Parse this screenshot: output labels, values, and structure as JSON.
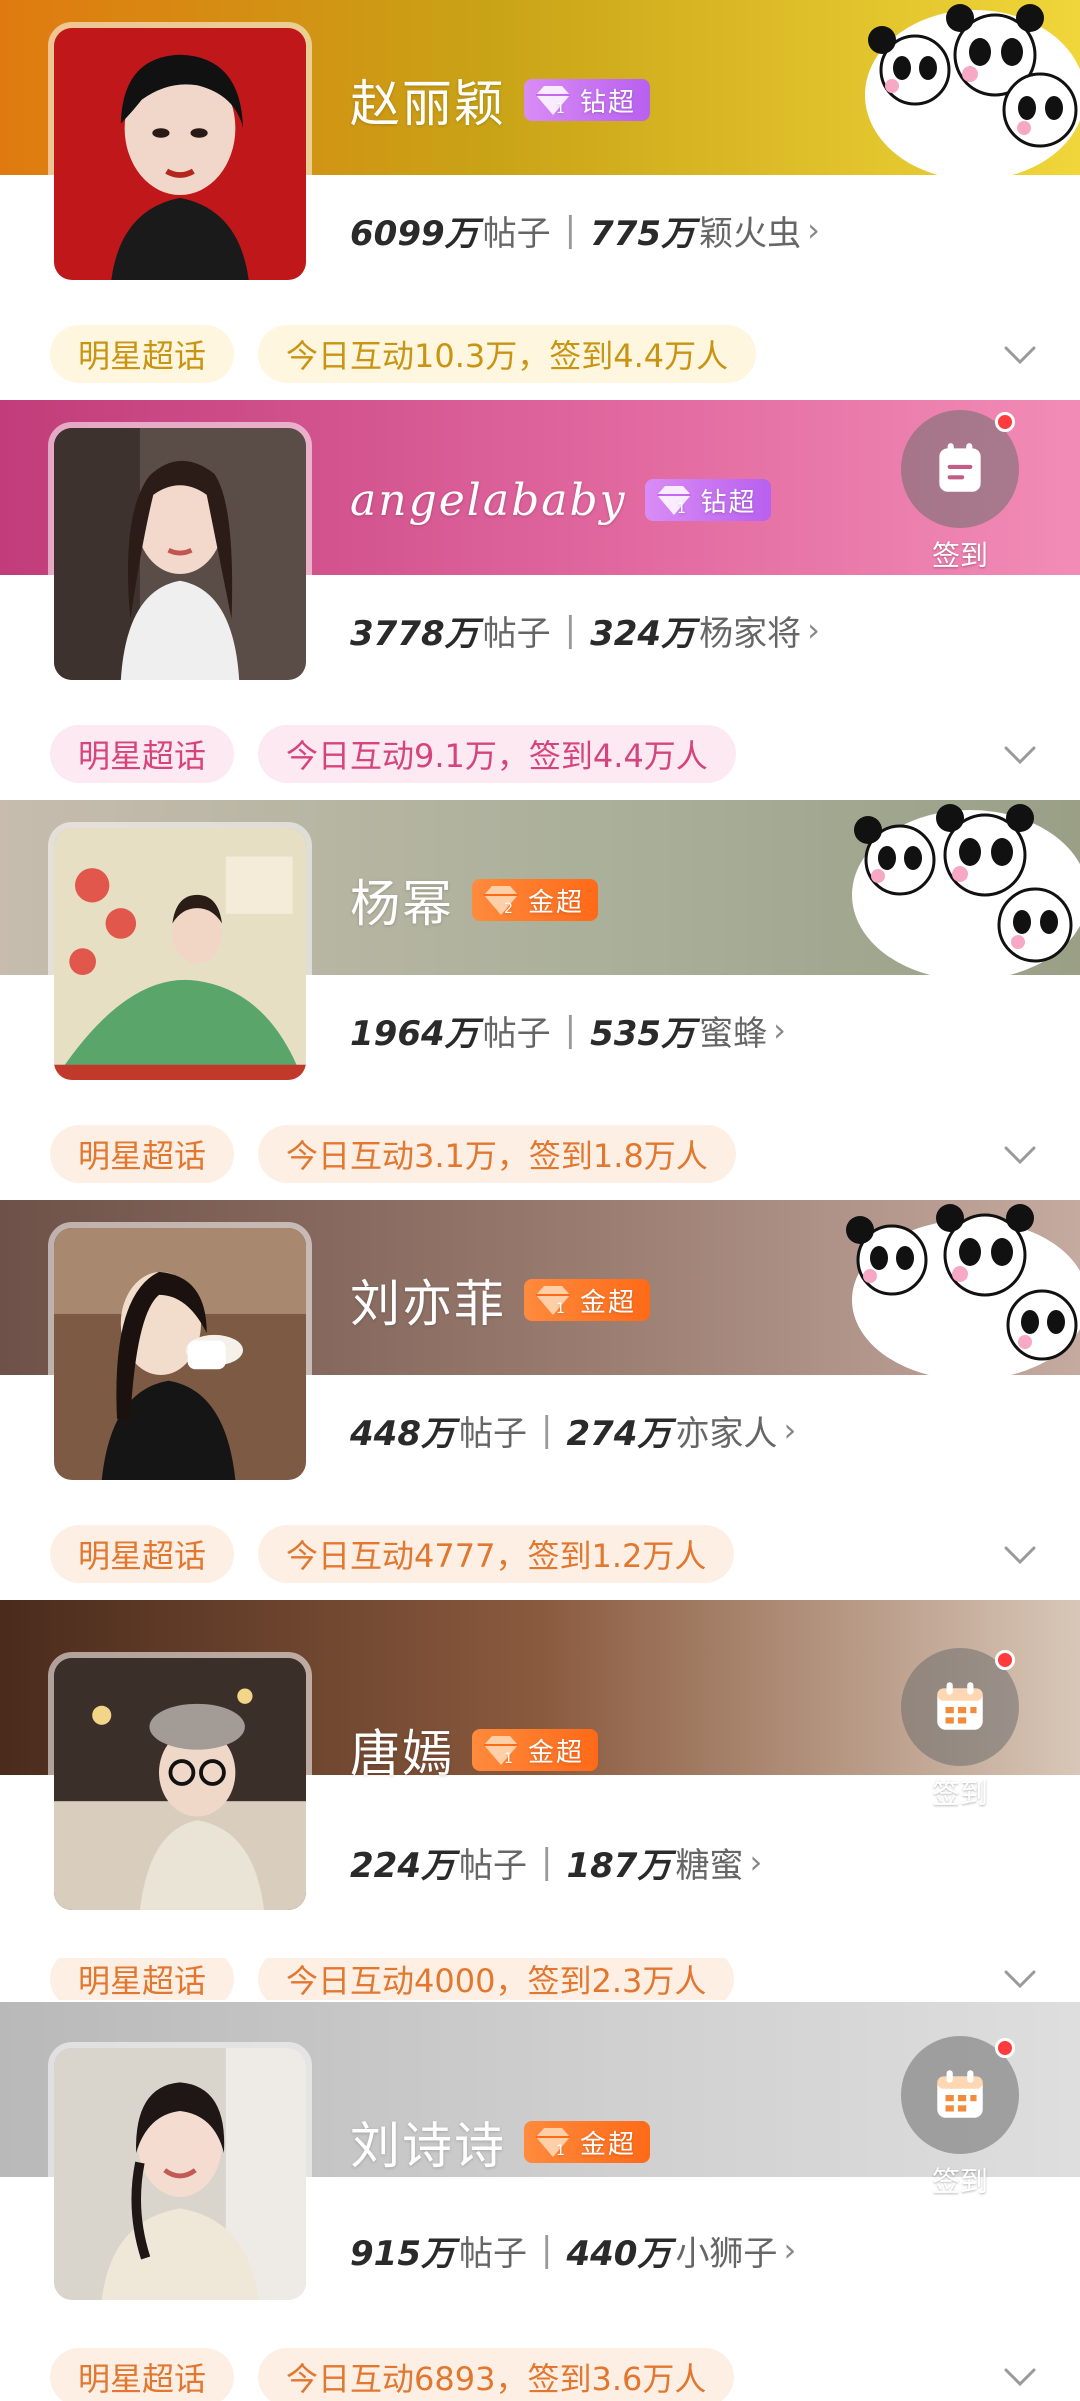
{
  "cards": [
    {
      "name": "赵丽颖",
      "tier": "钻超",
      "tier_type": "diamond",
      "tier_level": "1",
      "posts_num": "6099万",
      "posts_label": "帖子",
      "fans_num": "775万",
      "fans_label": "颖火虫",
      "chip_category": "明星超话",
      "chip_activity": "今日互动10.3万，签到4.4万人",
      "banner_colors": [
        "#e07a10",
        "#c9a316",
        "#f0d63a"
      ],
      "chip_color": "#c99412",
      "chip_bg": "#fff6df",
      "corner": "panda-sticker-image",
      "avatar_bg": "#c0171b"
    },
    {
      "name": "angelababy",
      "tier": "钻超",
      "tier_type": "diamond",
      "tier_level": "1",
      "posts_num": "3778万",
      "posts_label": "帖子",
      "fans_num": "324万",
      "fans_label": "杨家将",
      "chip_category": "明星超话",
      "chip_activity": "今日互动9.1万，签到4.4万人",
      "banner_colors": [
        "#c13c7a",
        "#e0669e",
        "#f28cb6"
      ],
      "chip_color": "#d6447e",
      "chip_bg": "#fde9f1",
      "corner": "checkin-button",
      "checkin_label": "签到",
      "checkin_icon": "note-icon",
      "avatar_bg": "#5a4c46"
    },
    {
      "name": "杨幂",
      "tier": "金超",
      "tier_type": "gold",
      "tier_level": "2",
      "posts_num": "1964万",
      "posts_label": "帖子",
      "fans_num": "535万",
      "fans_label": "蜜蜂",
      "chip_category": "明星超话",
      "chip_activity": "今日互动3.1万，签到1.8万人",
      "banner_colors": [
        "#c7bcae",
        "#aab09a",
        "#9a9f86"
      ],
      "chip_color": "#e2772f",
      "chip_bg": "#fdefe4",
      "corner": "panda-sticker-image",
      "avatar_bg": "#e7dfc4"
    },
    {
      "name": "刘亦菲",
      "tier": "金超",
      "tier_type": "gold",
      "tier_level": "1",
      "posts_num": "448万",
      "posts_label": "帖子",
      "fans_num": "274万",
      "fans_label": "亦家人",
      "chip_category": "明星超话",
      "chip_activity": "今日互动4777，签到1.2万人",
      "banner_colors": [
        "#6e5148",
        "#9a7c70",
        "#c5aaa0"
      ],
      "chip_color": "#e2772f",
      "chip_bg": "#fdefe4",
      "corner": "panda-sticker-image",
      "avatar_bg": "#7d5a43"
    },
    {
      "name": "唐嫣",
      "tier": "金超",
      "tier_type": "gold",
      "tier_level": "1",
      "posts_num": "224万",
      "posts_label": "帖子",
      "fans_num": "187万",
      "fans_label": "糖蜜",
      "chip_category": "明星超话",
      "chip_activity": "今日互动4000，签到2.3万人",
      "banner_colors": [
        "#4a2b1c",
        "#8a5a3e",
        "#d8c7b8"
      ],
      "chip_color": "#e2772f",
      "chip_bg": "#fdefe4",
      "corner": "checkin-button",
      "checkin_label": "签到",
      "checkin_icon": "calendar-icon",
      "avatar_bg": "#3b2f2a"
    },
    {
      "name": "刘诗诗",
      "tier": "金超",
      "tier_type": "gold",
      "tier_level": "1",
      "posts_num": "915万",
      "posts_label": "帖子",
      "fans_num": "440万",
      "fans_label": "小狮子",
      "chip_category": "明星超话",
      "chip_activity": "今日互动6893，签到3.6万人",
      "banner_colors": [
        "#b9b9b9",
        "#cfcfcf",
        "#dedede"
      ],
      "chip_color": "#e2772f",
      "chip_bg": "#fdefe4",
      "corner": "checkin-button",
      "checkin_label": "签到",
      "checkin_icon": "calendar-icon",
      "avatar_bg": "#d9d4cc"
    }
  ]
}
